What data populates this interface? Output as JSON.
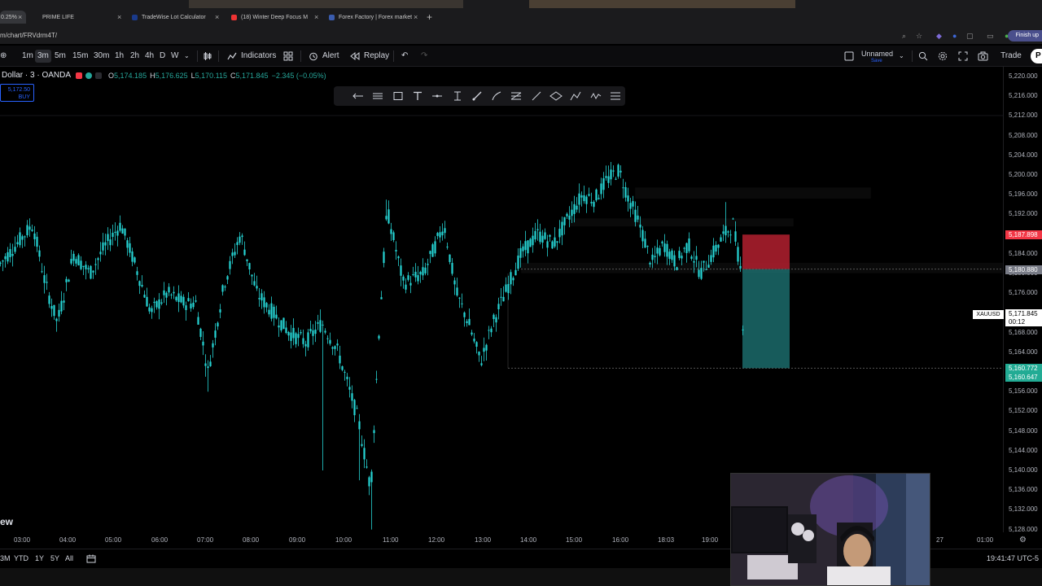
{
  "tabs": [
    {
      "title": "0.25%",
      "close": "×"
    },
    {
      "title": "PRIME LIFE",
      "close": "×"
    },
    {
      "title": "TradeWise Lot Calculator",
      "close": "×"
    },
    {
      "title": "(18) Winter Deep Focus M",
      "close": "×"
    },
    {
      "title": "Forex Factory | Forex market",
      "close": "×"
    }
  ],
  "new_tab": "+",
  "url": "m/chart/FRVdrm4T/",
  "finish_label": "Finish up",
  "timeframes": [
    "1m",
    "3m",
    "5m",
    "15m",
    "30m",
    "1h",
    "2h",
    "4h",
    "D",
    "W"
  ],
  "active_timeframe": "3m",
  "toolbar": {
    "indicators": "Indicators",
    "alert": "Alert",
    "replay": "Replay",
    "layout_name": "Unnamed",
    "layout_status": "Save",
    "trade": "Trade",
    "profile": "P"
  },
  "legend": {
    "symbol": "Dollar · 3 · OANDA",
    "open_label": "O",
    "open": "5,174.185",
    "high_label": "H",
    "high": "5,176.625",
    "low_label": "L",
    "low": "5,170.115",
    "close_label": "C",
    "close": "5,171.845",
    "change": "−2.345 (−0.05%)"
  },
  "buy_box": {
    "price": "5,172.50",
    "label": "BUY"
  },
  "price_axis": [
    "5,220.000",
    "5,216.000",
    "5,212.000",
    "5,208.000",
    "5,204.000",
    "5,200.000",
    "5,196.000",
    "5,192.000",
    "5,188.000",
    "5,184.000",
    "5,180.000",
    "5,176.000",
    "5,172.000",
    "5,168.000",
    "5,164.000",
    "5,160.000",
    "5,156.000",
    "5,152.000",
    "5,148.000",
    "5,144.000",
    "5,140.000",
    "5,136.000",
    "5,132.000",
    "5,128.000"
  ],
  "price_badges": {
    "stop": "5,187.898",
    "entry": "5,180.880",
    "last": "5,171.845",
    "countdown": "00:12",
    "target": "5,160.772",
    "target2": "5,160.647",
    "symbol_tag": "XAUUSD"
  },
  "time_axis": [
    "03:00",
    "04:00",
    "05:00",
    "06:00",
    "07:00",
    "08:00",
    "09:00",
    "10:00",
    "11:00",
    "12:00",
    "13:00",
    "14:00",
    "15:00",
    "16:00",
    "18:03",
    "19:00",
    "27",
    "01:00"
  ],
  "partial_logo": "ew",
  "ranges": [
    "3M",
    "YTD",
    "1Y",
    "5Y",
    "All"
  ],
  "clock": "19:41:47 UTC-5",
  "colors": {
    "candle": "#26d4d4",
    "stop_zone": "#b3202f",
    "target_zone": "#1f7a7a",
    "stop_badge": "#f23645",
    "target_badge": "#22ab94",
    "last_badge": "#ffffff"
  }
}
